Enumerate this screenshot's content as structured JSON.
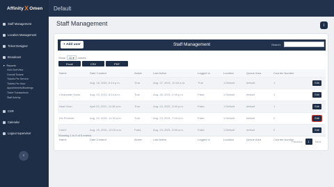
{
  "brand": {
    "logo_left": "Affinity",
    "logo_x": "X",
    "logo_right": "Omen"
  },
  "topbar": {
    "title": "Default"
  },
  "sidebar": {
    "items": [
      {
        "label": "Staff Management"
      },
      {
        "label": "Location Management"
      },
      {
        "label": "Ticket Designer"
      },
      {
        "label": "Broadcast"
      }
    ],
    "reports": {
      "label": "Reports",
      "children": [
        "Visit OverView",
        "Overall Tickets",
        "Tickets Per Service",
        "Tickets Per Hour",
        "Appointments/Bookings",
        "Ticket Transactions",
        "Staff Activity"
      ]
    },
    "lower_items": [
      {
        "label": "CSR"
      },
      {
        "label": "Calendar"
      },
      {
        "label": "Logout supervisor"
      }
    ],
    "collapse_glyph": "‹"
  },
  "page": {
    "title": "Staff Management",
    "help_glyph": "i"
  },
  "table_header": {
    "add_user": "+ Add user",
    "title": "Staff Management",
    "search_label": "Search:",
    "search_value": ""
  },
  "length": {
    "show": "Show",
    "value": "10",
    "entries": "entries"
  },
  "exports": [
    "Excel",
    "CSV",
    "PDF"
  ],
  "columns": [
    "Name",
    "Date Created",
    "Active",
    "Last Active",
    "Logged In",
    "Location",
    "Queue Area",
    "Counter Number",
    ""
  ],
  "rows": [
    [
      "",
      "Aug. 18, 2021, 8:14 p.m.",
      "True",
      "Aug. 27, 2021, 10:10 a.m.",
      "True",
      "1 Default",
      "default",
      "1",
      "Edit"
    ],
    [
      "Clearwater Kiosk",
      "Aug. 24, 2021, 8:14 a.m.",
      "True",
      "Aug. 26, 2021, 2:40 p.m.",
      "False",
      "1 Default",
      "default",
      "1",
      "Edit"
    ],
    [
      "Neal Khan",
      "April 23, 2021, 11:38 a.m.",
      "True",
      "Aug. 24, 2021, 3:40 p.m.",
      "False",
      "1 Default",
      "default",
      "1",
      "Edit"
    ],
    [
      "Kie Pimente",
      "Aug. 19, 2021, 11:34 a.m.",
      "True",
      "Aug. 24, 2021, 7:43 a.m.",
      "False",
      "1 Default",
      "default",
      "2",
      "Edit"
    ],
    [
      "User1",
      "Aug. 19, 2021, 10:19 a.m.",
      "False",
      "Aug. 24, 2021, 9:56 a.m.",
      "False",
      "1 Default",
      "default",
      "2",
      "Edit"
    ]
  ],
  "info": "Showing 1 to 5 of 5 entries",
  "pagination": {
    "prev": "Previous",
    "page": "1",
    "next": "Next"
  }
}
